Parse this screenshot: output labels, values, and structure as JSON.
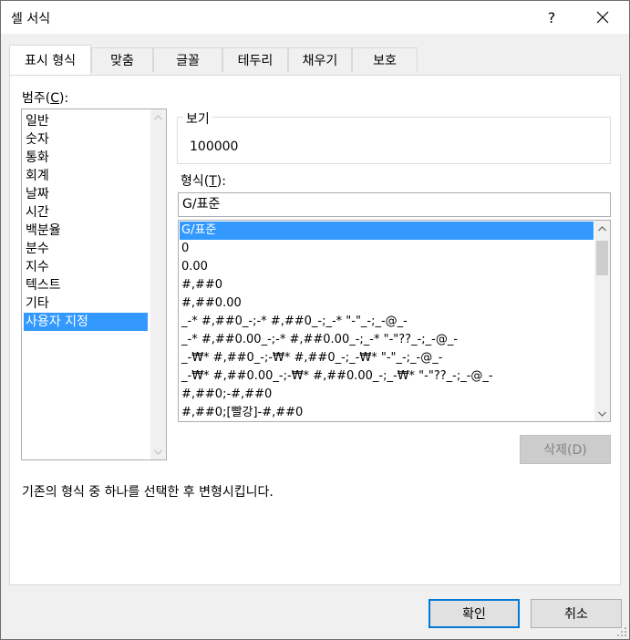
{
  "window": {
    "title": "셀 서식",
    "help_label": "?",
    "close_label": "✕"
  },
  "tabs": [
    {
      "label": "표시 형식",
      "active": true
    },
    {
      "label": "맞춤",
      "active": false
    },
    {
      "label": "글꼴",
      "active": false
    },
    {
      "label": "테두리",
      "active": false
    },
    {
      "label": "채우기",
      "active": false
    },
    {
      "label": "보호",
      "active": false
    }
  ],
  "category": {
    "label_prefix": "범주(",
    "label_key": "C",
    "label_suffix": "):",
    "items": [
      "일반",
      "숫자",
      "통화",
      "회계",
      "날짜",
      "시간",
      "백분율",
      "분수",
      "지수",
      "텍스트",
      "기타",
      "사용자 지정"
    ],
    "selected_index": 11
  },
  "sample": {
    "legend": "보기",
    "value": "100000"
  },
  "format": {
    "label_prefix": "형식(",
    "label_key": "T",
    "label_suffix": "):",
    "input_value": "G/표준",
    "items": [
      "G/표준",
      "0",
      "0.00",
      "#,##0",
      "#,##0.00",
      "_-* #,##0_-;-* #,##0_-;_-* \"-\"_-;_-@_-",
      "_-* #,##0.00_-;-* #,##0.00_-;_-* \"-\"??_-;_-@_-",
      "_-₩* #,##0_-;-₩* #,##0_-;_-₩* \"-\"_-;_-@_-",
      "_-₩* #,##0.00_-;-₩* #,##0.00_-;_-₩* \"-\"??_-;_-@_-",
      "#,##0;-#,##0",
      "#,##0;[빨강]-#,##0"
    ],
    "selected_index": 0
  },
  "delete_button": "삭제(D)",
  "description": "기존의 형식 중 하나를 선택한 후 변형시킵니다.",
  "ok_button": "확인",
  "cancel_button": "취소"
}
